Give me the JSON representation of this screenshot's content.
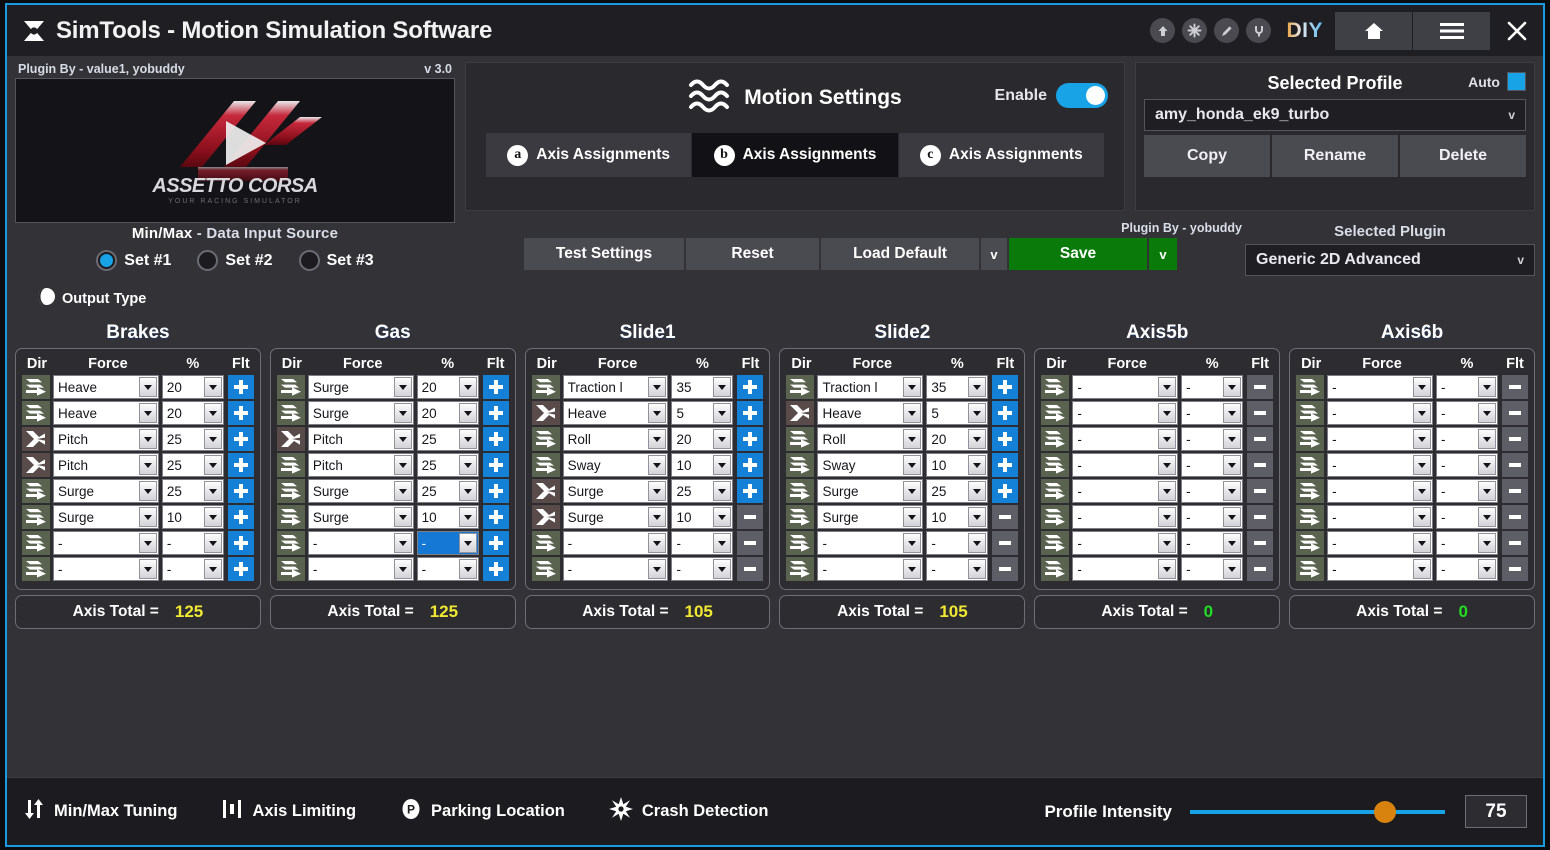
{
  "window": {
    "title": "SimTools - Motion Simulation Software",
    "logo_icon": "simtools-hourglass-icon"
  },
  "titlebar": {
    "icons": [
      {
        "name": "upload-circle-icon",
        "glyph": "⬆"
      },
      {
        "name": "asterisk-circle-icon",
        "glyph": "✳"
      },
      {
        "name": "pencil-circle-icon",
        "glyph": "✎"
      },
      {
        "name": "plug-circle-icon",
        "glyph": "⏻"
      }
    ],
    "diy_label": "DIY",
    "home_label": "home-icon",
    "menu_label": "hamburger-menu-icon",
    "close_label": "close-icon"
  },
  "game_panel": {
    "plugin_by": "Plugin By - value1, yobuddy",
    "version": "v 3.0",
    "game_title": "ASSETTO CORSA",
    "game_subtitle": "YOUR RACING SIMULATOR"
  },
  "motion": {
    "title": "Motion Settings",
    "wave_icon": "waves-icon",
    "enable_label": "Enable",
    "enable_on": true,
    "tabs": [
      {
        "badge": "a",
        "label": "Axis Assignments",
        "active": false
      },
      {
        "badge": "b",
        "label": "Axis Assignments",
        "active": true
      },
      {
        "badge": "c",
        "label": "Axis Assignments",
        "active": false
      }
    ]
  },
  "profile": {
    "title": "Selected Profile",
    "auto_label": "Auto",
    "auto_checked": true,
    "selected": "amy_honda_ek9_turbo",
    "caret": "v",
    "buttons": [
      "Copy",
      "Rename",
      "Delete"
    ]
  },
  "minmax": {
    "title_prefix": "Min/Max",
    "title_rest": " - Data Input Source",
    "sets": [
      {
        "label": "Set #1",
        "selected": true
      },
      {
        "label": "Set #2",
        "selected": false
      },
      {
        "label": "Set #3",
        "selected": false
      }
    ],
    "output_type_label": "Output Type",
    "output_type_icon": "sphere-icon"
  },
  "actions": {
    "plugin_by": "Plugin By - yobuddy",
    "test_settings": "Test Settings",
    "reset": "Reset",
    "load_default": "Load Default",
    "load_caret": "v",
    "save": "Save",
    "save_caret": "v",
    "save_color": "#0a7a0a"
  },
  "plugin": {
    "title": "Selected Plugin",
    "selected": "Generic 2D Advanced",
    "caret": "v"
  },
  "axis_table": {
    "headers": {
      "dir": "Dir",
      "force": "Force",
      "pct": "%",
      "flt": "Flt"
    },
    "total_label": "Axis Total =",
    "empty": "-",
    "total_color_active": "#f0e832",
    "total_color_zero": "#22dd22"
  },
  "axes": [
    {
      "name": "Brakes",
      "total": "125",
      "total_zero": false,
      "rows": [
        {
          "dir": "straight",
          "force": "Heave",
          "pct": "20",
          "flt": "plus",
          "focus": false
        },
        {
          "dir": "straight",
          "force": "Heave",
          "pct": "20",
          "flt": "plus",
          "focus": false
        },
        {
          "dir": "cross",
          "force": "Pitch",
          "pct": "25",
          "flt": "plus",
          "focus": false
        },
        {
          "dir": "cross",
          "force": "Pitch",
          "pct": "25",
          "flt": "plus",
          "focus": false
        },
        {
          "dir": "straight",
          "force": "Surge",
          "pct": "25",
          "flt": "plus",
          "focus": false
        },
        {
          "dir": "straight",
          "force": "Surge",
          "pct": "10",
          "flt": "plus",
          "focus": false
        },
        {
          "dir": "straight",
          "force": "-",
          "pct": "-",
          "flt": "plus",
          "focus": false
        },
        {
          "dir": "straight",
          "force": "-",
          "pct": "-",
          "flt": "plus",
          "focus": false
        }
      ]
    },
    {
      "name": "Gas",
      "total": "125",
      "total_zero": false,
      "rows": [
        {
          "dir": "straight",
          "force": "Surge",
          "pct": "20",
          "flt": "plus",
          "focus": false
        },
        {
          "dir": "straight",
          "force": "Surge",
          "pct": "20",
          "flt": "plus",
          "focus": false
        },
        {
          "dir": "cross",
          "force": "Pitch",
          "pct": "25",
          "flt": "plus",
          "focus": false
        },
        {
          "dir": "straight",
          "force": "Pitch",
          "pct": "25",
          "flt": "plus",
          "focus": false
        },
        {
          "dir": "straight",
          "force": "Surge",
          "pct": "25",
          "flt": "plus",
          "focus": false
        },
        {
          "dir": "straight",
          "force": "Surge",
          "pct": "10",
          "flt": "plus",
          "focus": false
        },
        {
          "dir": "straight",
          "force": "-",
          "pct": "-",
          "flt": "plus",
          "focus": true
        },
        {
          "dir": "straight",
          "force": "-",
          "pct": "-",
          "flt": "plus",
          "focus": false
        }
      ]
    },
    {
      "name": "Slide1",
      "total": "105",
      "total_zero": false,
      "rows": [
        {
          "dir": "straight",
          "force": "Traction l",
          "pct": "35",
          "flt": "plus",
          "focus": false
        },
        {
          "dir": "cross",
          "force": "Heave",
          "pct": "5",
          "flt": "plus",
          "focus": false
        },
        {
          "dir": "straight",
          "force": "Roll",
          "pct": "20",
          "flt": "plus",
          "focus": false
        },
        {
          "dir": "straight",
          "force": "Sway",
          "pct": "10",
          "flt": "plus",
          "focus": false
        },
        {
          "dir": "cross",
          "force": "Surge",
          "pct": "25",
          "flt": "plus",
          "focus": false
        },
        {
          "dir": "cross",
          "force": "Surge",
          "pct": "10",
          "flt": "minus",
          "focus": false
        },
        {
          "dir": "straight",
          "force": "-",
          "pct": "-",
          "flt": "minus",
          "focus": false
        },
        {
          "dir": "straight",
          "force": "-",
          "pct": "-",
          "flt": "minus",
          "focus": false
        }
      ]
    },
    {
      "name": "Slide2",
      "total": "105",
      "total_zero": false,
      "rows": [
        {
          "dir": "straight",
          "force": "Traction l",
          "pct": "35",
          "flt": "plus",
          "focus": false
        },
        {
          "dir": "cross",
          "force": "Heave",
          "pct": "5",
          "flt": "plus",
          "focus": false
        },
        {
          "dir": "straight",
          "force": "Roll",
          "pct": "20",
          "flt": "plus",
          "focus": false
        },
        {
          "dir": "straight",
          "force": "Sway",
          "pct": "10",
          "flt": "plus",
          "focus": false
        },
        {
          "dir": "straight",
          "force": "Surge",
          "pct": "25",
          "flt": "plus",
          "focus": false
        },
        {
          "dir": "straight",
          "force": "Surge",
          "pct": "10",
          "flt": "minus",
          "focus": false
        },
        {
          "dir": "straight",
          "force": "-",
          "pct": "-",
          "flt": "minus",
          "focus": false
        },
        {
          "dir": "straight",
          "force": "-",
          "pct": "-",
          "flt": "minus",
          "focus": false
        }
      ]
    },
    {
      "name": "Axis5b",
      "total": "0",
      "total_zero": true,
      "rows": [
        {
          "dir": "straight",
          "force": "-",
          "pct": "-",
          "flt": "minus",
          "focus": false
        },
        {
          "dir": "straight",
          "force": "-",
          "pct": "-",
          "flt": "minus",
          "focus": false
        },
        {
          "dir": "straight",
          "force": "-",
          "pct": "-",
          "flt": "minus",
          "focus": false
        },
        {
          "dir": "straight",
          "force": "-",
          "pct": "-",
          "flt": "minus",
          "focus": false
        },
        {
          "dir": "straight",
          "force": "-",
          "pct": "-",
          "flt": "minus",
          "focus": false
        },
        {
          "dir": "straight",
          "force": "-",
          "pct": "-",
          "flt": "minus",
          "focus": false
        },
        {
          "dir": "straight",
          "force": "-",
          "pct": "-",
          "flt": "minus",
          "focus": false
        },
        {
          "dir": "straight",
          "force": "-",
          "pct": "-",
          "flt": "minus",
          "focus": false
        }
      ]
    },
    {
      "name": "Axis6b",
      "total": "0",
      "total_zero": true,
      "rows": [
        {
          "dir": "straight",
          "force": "-",
          "pct": "-",
          "flt": "minus",
          "focus": false
        },
        {
          "dir": "straight",
          "force": "-",
          "pct": "-",
          "flt": "minus",
          "focus": false
        },
        {
          "dir": "straight",
          "force": "-",
          "pct": "-",
          "flt": "minus",
          "focus": false
        },
        {
          "dir": "straight",
          "force": "-",
          "pct": "-",
          "flt": "minus",
          "focus": false
        },
        {
          "dir": "straight",
          "force": "-",
          "pct": "-",
          "flt": "minus",
          "focus": false
        },
        {
          "dir": "straight",
          "force": "-",
          "pct": "-",
          "flt": "minus",
          "focus": false
        },
        {
          "dir": "straight",
          "force": "-",
          "pct": "-",
          "flt": "minus",
          "focus": false
        },
        {
          "dir": "straight",
          "force": "-",
          "pct": "-",
          "flt": "minus",
          "focus": false
        }
      ]
    }
  ],
  "bottombar": {
    "items": [
      {
        "icon": "updown-arrows-icon",
        "label": "Min/Max Tuning"
      },
      {
        "icon": "bar-limits-icon",
        "label": "Axis Limiting"
      },
      {
        "icon": "parking-p-icon",
        "label": "Parking Location"
      },
      {
        "icon": "crash-burst-icon",
        "label": "Crash Detection"
      }
    ],
    "intensity_label": "Profile Intensity",
    "intensity_value": "75",
    "slider_accent": "#17a3e5",
    "thumb_color": "#d9830f"
  }
}
